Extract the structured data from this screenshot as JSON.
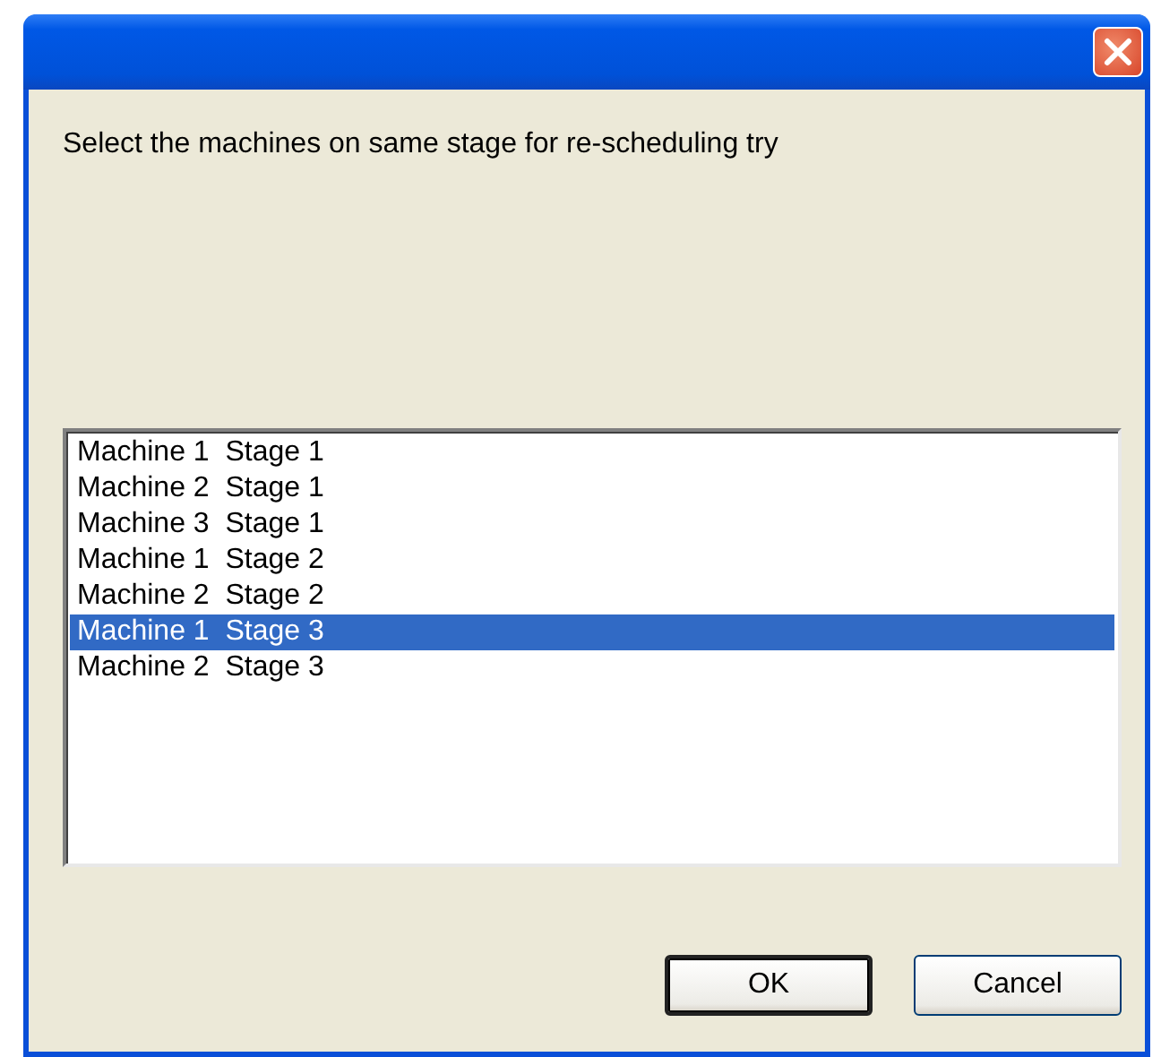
{
  "dialog": {
    "message": "Select the machines on same stage for re-scheduling try"
  },
  "list": {
    "items": [
      {
        "label": "Machine 1  Stage 1",
        "selected": false
      },
      {
        "label": "Machine 2  Stage 1",
        "selected": false
      },
      {
        "label": "Machine 3  Stage 1",
        "selected": false
      },
      {
        "label": "Machine 1  Stage 2",
        "selected": false
      },
      {
        "label": "Machine 2  Stage 2",
        "selected": false
      },
      {
        "label": "Machine 1  Stage 3",
        "selected": true
      },
      {
        "label": "Machine 2  Stage 3",
        "selected": false
      }
    ]
  },
  "buttons": [
    {
      "label": "OK",
      "default": true
    },
    {
      "label": "Cancel",
      "default": false
    }
  ]
}
